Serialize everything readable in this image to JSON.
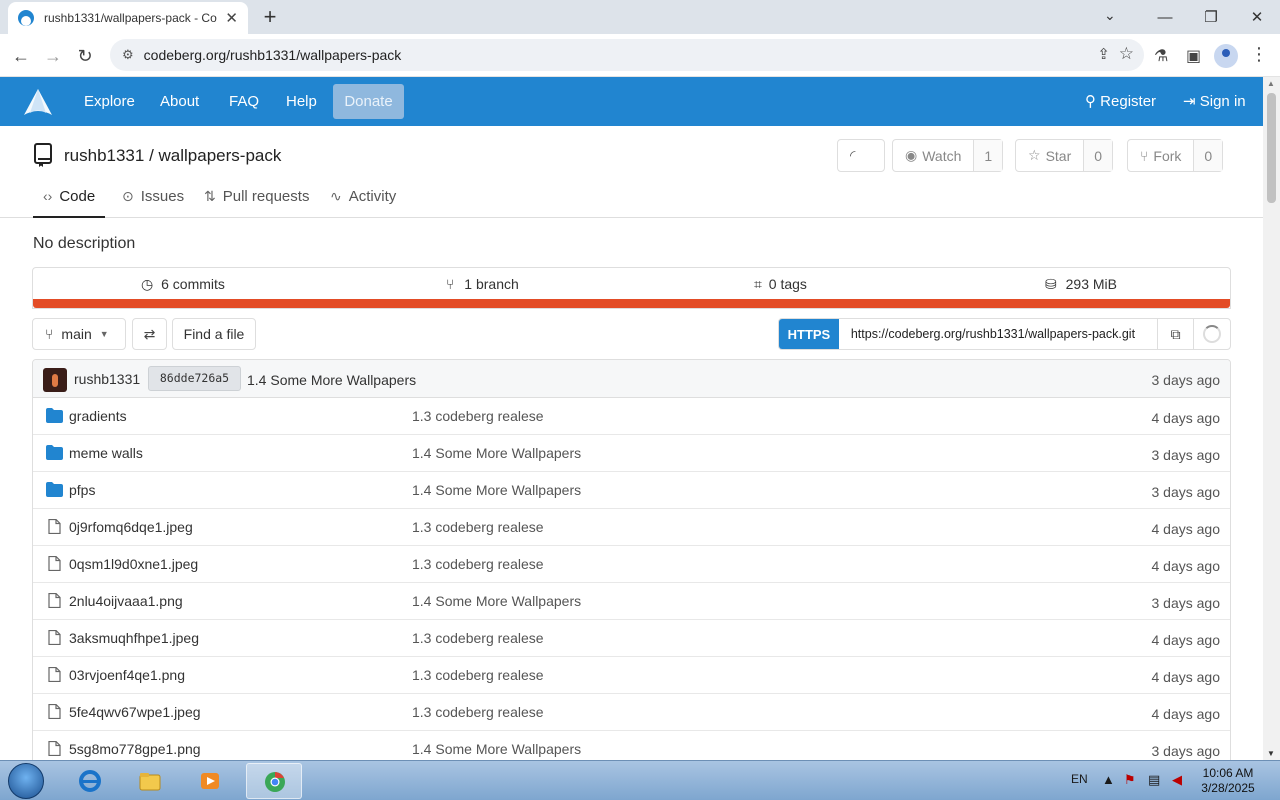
{
  "browser": {
    "tab_title": "rushb1331/wallpapers-pack - Co",
    "url": "codeberg.org/rushb1331/wallpapers-pack"
  },
  "site_nav": {
    "items": [
      "Explore",
      "About",
      "FAQ",
      "Help"
    ],
    "donate": "Donate",
    "register": "Register",
    "signin": "Sign in",
    "accent_color": "#2185d0"
  },
  "repo": {
    "owner": "rushb1331",
    "name": "wallpapers-pack",
    "title": "rushb1331 / wallpapers-pack",
    "watch_label": "Watch",
    "watch_count": "1",
    "star_label": "Star",
    "star_count": "0",
    "fork_label": "Fork",
    "fork_count": "0",
    "tabs": [
      {
        "label": "Code",
        "icon": "code-icon"
      },
      {
        "label": "Issues",
        "icon": "issues-icon"
      },
      {
        "label": "Pull requests",
        "icon": "pull-request-icon"
      },
      {
        "label": "Activity",
        "icon": "activity-icon"
      }
    ],
    "description": "No description"
  },
  "stats": {
    "commits": "6 commits",
    "branches": "1 branch",
    "tags": "0 tags",
    "size": "293 MiB",
    "language_color": "#e34c26"
  },
  "controls": {
    "branch": "main",
    "find_file": "Find a file",
    "clone_protocol": "HTTPS",
    "clone_url": "https://codeberg.org/rushb1331/wallpapers-pack.git"
  },
  "last_commit": {
    "author": "rushb1331",
    "sha": "86dde726a5",
    "message": "1.4 Some More Wallpapers",
    "when": "3 days ago"
  },
  "files": [
    {
      "type": "folder",
      "name": "gradients",
      "message": "1.3 codeberg realese",
      "when": "4 days ago"
    },
    {
      "type": "folder",
      "name": "meme walls",
      "message": "1.4 Some More Wallpapers",
      "when": "3 days ago"
    },
    {
      "type": "folder",
      "name": "pfps",
      "message": "1.4 Some More Wallpapers",
      "when": "3 days ago"
    },
    {
      "type": "file",
      "name": "0j9rfomq6dqe1.jpeg",
      "message": "1.3 codeberg realese",
      "when": "4 days ago"
    },
    {
      "type": "file",
      "name": "0qsm1l9d0xne1.jpeg",
      "message": "1.3 codeberg realese",
      "when": "4 days ago"
    },
    {
      "type": "file",
      "name": "2nlu4oijvaaa1.png",
      "message": "1.4 Some More Wallpapers",
      "when": "3 days ago"
    },
    {
      "type": "file",
      "name": "3aksmuqhfhpe1.jpeg",
      "message": "1.3 codeberg realese",
      "when": "4 days ago"
    },
    {
      "type": "file",
      "name": "03rvjoenf4qe1.png",
      "message": "1.3 codeberg realese",
      "when": "4 days ago"
    },
    {
      "type": "file",
      "name": "5fe4qwv67wpe1.jpeg",
      "message": "1.3 codeberg realese",
      "when": "4 days ago"
    },
    {
      "type": "file",
      "name": "5sg8mo778gpe1.png",
      "message": "1.4 Some More Wallpapers",
      "when": "3 days ago"
    }
  ],
  "taskbar": {
    "lang": "EN",
    "time": "10:06 AM",
    "date": "3/28/2025"
  }
}
